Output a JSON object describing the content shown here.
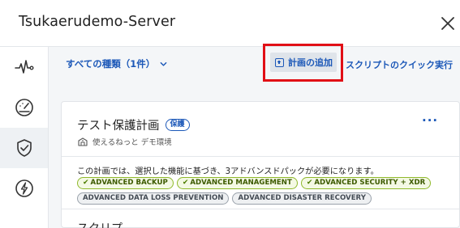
{
  "header": {
    "title": "Tsukaerudemo-Server"
  },
  "sidebar": {
    "items": [
      {
        "name": "activity",
        "icon": "pulse-icon",
        "active": false
      },
      {
        "name": "monitoring",
        "icon": "gauge-icon",
        "active": false
      },
      {
        "name": "protection",
        "icon": "shield-check-icon",
        "active": true
      },
      {
        "name": "power",
        "icon": "power-bolt-icon",
        "active": false
      }
    ]
  },
  "toolbar": {
    "filter_label": "すべての種類（1件）",
    "add_plan_label": "計画の追加",
    "quick_run_label": "スクリプトのクイック実行"
  },
  "plan_card": {
    "title": "テスト保護計画",
    "badge": "保護",
    "more_label": "···",
    "subtitle": "使えるねっと デモ環境",
    "description": "この計画では、選択した機能に基づき、3アドバンスドパックが必要になります。",
    "packs": [
      {
        "label": "ADVANCED BACKUP",
        "enabled": true
      },
      {
        "label": "ADVANCED MANAGEMENT",
        "enabled": true
      },
      {
        "label": "ADVANCED SECURITY + XDR",
        "enabled": true
      },
      {
        "label": "ADVANCED DATA LOSS PREVENTION",
        "enabled": false
      },
      {
        "label": "ADVANCED DISASTER RECOVERY",
        "enabled": false
      }
    ],
    "next_item_text": "スクリプ"
  },
  "colors": {
    "accent": "#1c58b8",
    "highlight_frame": "#e10f16",
    "enabled_chip_border": "#8fb92b",
    "disabled_chip_border": "#9aa2ab"
  }
}
